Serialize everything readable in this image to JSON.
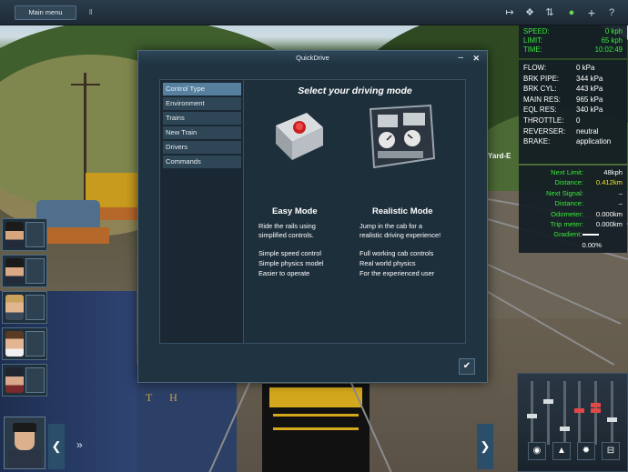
{
  "topbar": {
    "main_menu_label": "Main menu",
    "separator": "ll",
    "icons": [
      "track-icon",
      "camera-icon",
      "tools-icon",
      "leaf-icon",
      "plus-icon",
      "help-icon"
    ],
    "icon_glyphs": [
      "↦",
      "❖",
      "⇅",
      "●",
      "+",
      "?"
    ]
  },
  "hud_speed": {
    "rows": [
      {
        "label": "SPEED:",
        "value": "0 kph"
      },
      {
        "label": "LIMIT:",
        "value": "65 kph"
      },
      {
        "label": "TIME:",
        "value": "10:02:49"
      }
    ]
  },
  "hud_brake": {
    "rows": [
      {
        "label": "FLOW:",
        "value": "0 kPa"
      },
      {
        "label": "BRK PIPE:",
        "value": "344 kPa"
      },
      {
        "label": "BRK CYL:",
        "value": "443 kPa"
      },
      {
        "label": "MAIN RES:",
        "value": "965 kPa"
      },
      {
        "label": "EQL RES:",
        "value": "340 kPa"
      },
      {
        "label": "THROTTLE:",
        "value": "0"
      },
      {
        "label": "REVERSER:",
        "value": "neutral"
      },
      {
        "label": "BRAKE:",
        "value": "application"
      }
    ]
  },
  "hud_nav": {
    "rows": [
      {
        "label": "Next Limit:",
        "value": "48kph"
      },
      {
        "label": "Distance:",
        "value": "0.412km"
      },
      {
        "label": "Next Signal:",
        "value": "–"
      },
      {
        "label": "Distance:",
        "value": "–"
      },
      {
        "label": "Odometer:",
        "value": "0.000km"
      },
      {
        "label": "Trip meter:",
        "value": "0.000km"
      },
      {
        "label": "Gradient:",
        "value": "0.00%"
      }
    ],
    "highlight_color": "#f2e21c"
  },
  "scene": {
    "yard_label": "Yard-E",
    "loco_lettering": "T H"
  },
  "dialog": {
    "title": "QuickDrive",
    "minimize_glyph": "–",
    "close_glyph": "✕",
    "sidebar_items": [
      "Control Type",
      "Environment",
      "Trains",
      "New Train",
      "Drivers",
      "Commands"
    ],
    "active_index": 0,
    "heading": "Select your driving mode",
    "easy": {
      "title": "Easy Mode",
      "desc": [
        "Ride the rails using",
        "simplified controls."
      ],
      "features": [
        "Simple speed control",
        "Simple physics model",
        "Easier to operate"
      ]
    },
    "realistic": {
      "title": "Realistic Mode",
      "desc": [
        "Jump in the cab for a",
        "realistic driving experience!"
      ],
      "features": [
        "Full working cab controls",
        "Real world physics",
        "For the experienced user"
      ]
    },
    "ok_glyph": "✔"
  },
  "bottom": {
    "left_arrow": "❮",
    "double_arrow": "»",
    "right_arrow": "❯",
    "control_buttons": [
      "eye-icon",
      "up-icon",
      "light-icon",
      "horn-icon"
    ],
    "control_glyphs": [
      "◉",
      "▲",
      "✹",
      "⊟"
    ]
  },
  "colors": {
    "accent": "#56809e",
    "hud_green": "#39e83a",
    "panel_bg": "#203341"
  }
}
